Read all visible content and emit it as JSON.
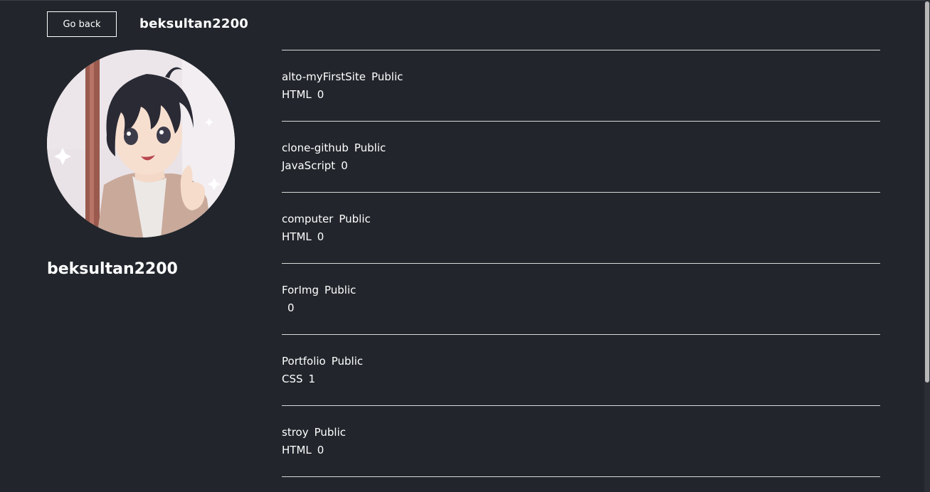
{
  "header": {
    "back_label": "Go back",
    "username": "beksultan2200"
  },
  "profile": {
    "name": "beksultan2200"
  },
  "repos": [
    {
      "name": "alto-myFirstSite",
      "visibility": "Public",
      "language": "HTML",
      "stars": "0"
    },
    {
      "name": "clone-github",
      "visibility": "Public",
      "language": "JavaScript",
      "stars": "0"
    },
    {
      "name": "computer",
      "visibility": "Public",
      "language": "HTML",
      "stars": "0"
    },
    {
      "name": "ForImg",
      "visibility": "Public",
      "language": "",
      "stars": "0"
    },
    {
      "name": "Portfolio",
      "visibility": "Public",
      "language": "CSS",
      "stars": "1"
    },
    {
      "name": "stroy",
      "visibility": "Public",
      "language": "HTML",
      "stars": "0"
    }
  ],
  "colors": {
    "background": "#22262c",
    "text": "#ffffff",
    "divider": "#d9d9d9"
  }
}
